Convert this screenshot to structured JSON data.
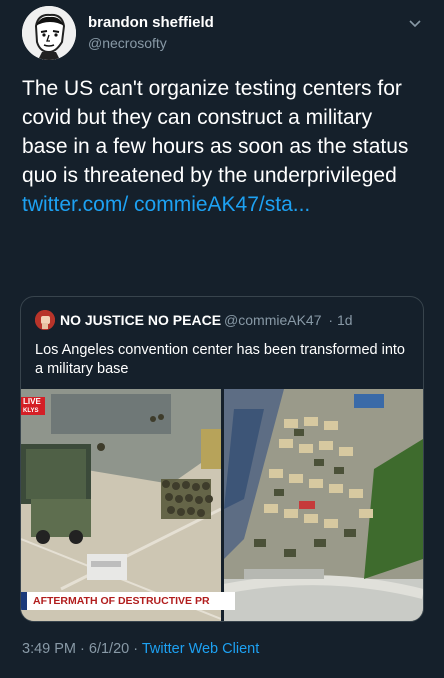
{
  "author": {
    "name": "brandon sheffield",
    "handle": "@necrosofty",
    "avatar_icon": "sketch-face-avatar-icon"
  },
  "tweet": {
    "text": "The US can't organize testing centers for covid but they can construct a military base in a few hours as soon as the status quo is threatened by the underprivileged",
    "link": "twitter.com/ commieAK47/sta..."
  },
  "quoted": {
    "name": "NO JUSTICE NO PEACE",
    "handle": "@commieAK47",
    "time": "· 1d",
    "text": "Los Angeles convention center has been transformed into a military base",
    "media": {
      "live_label": "LIVE",
      "live_sub": "KLYS",
      "banner": "AFTERMATH OF DESTRUCTIVE PR"
    }
  },
  "footer": {
    "time": "3:49 PM",
    "date": "· 6/1/20 ·",
    "client": "Twitter Web Client"
  },
  "colors": {
    "background": "#15202b",
    "link": "#1da1f2",
    "secondary": "#8899a6",
    "border": "#38444d"
  }
}
